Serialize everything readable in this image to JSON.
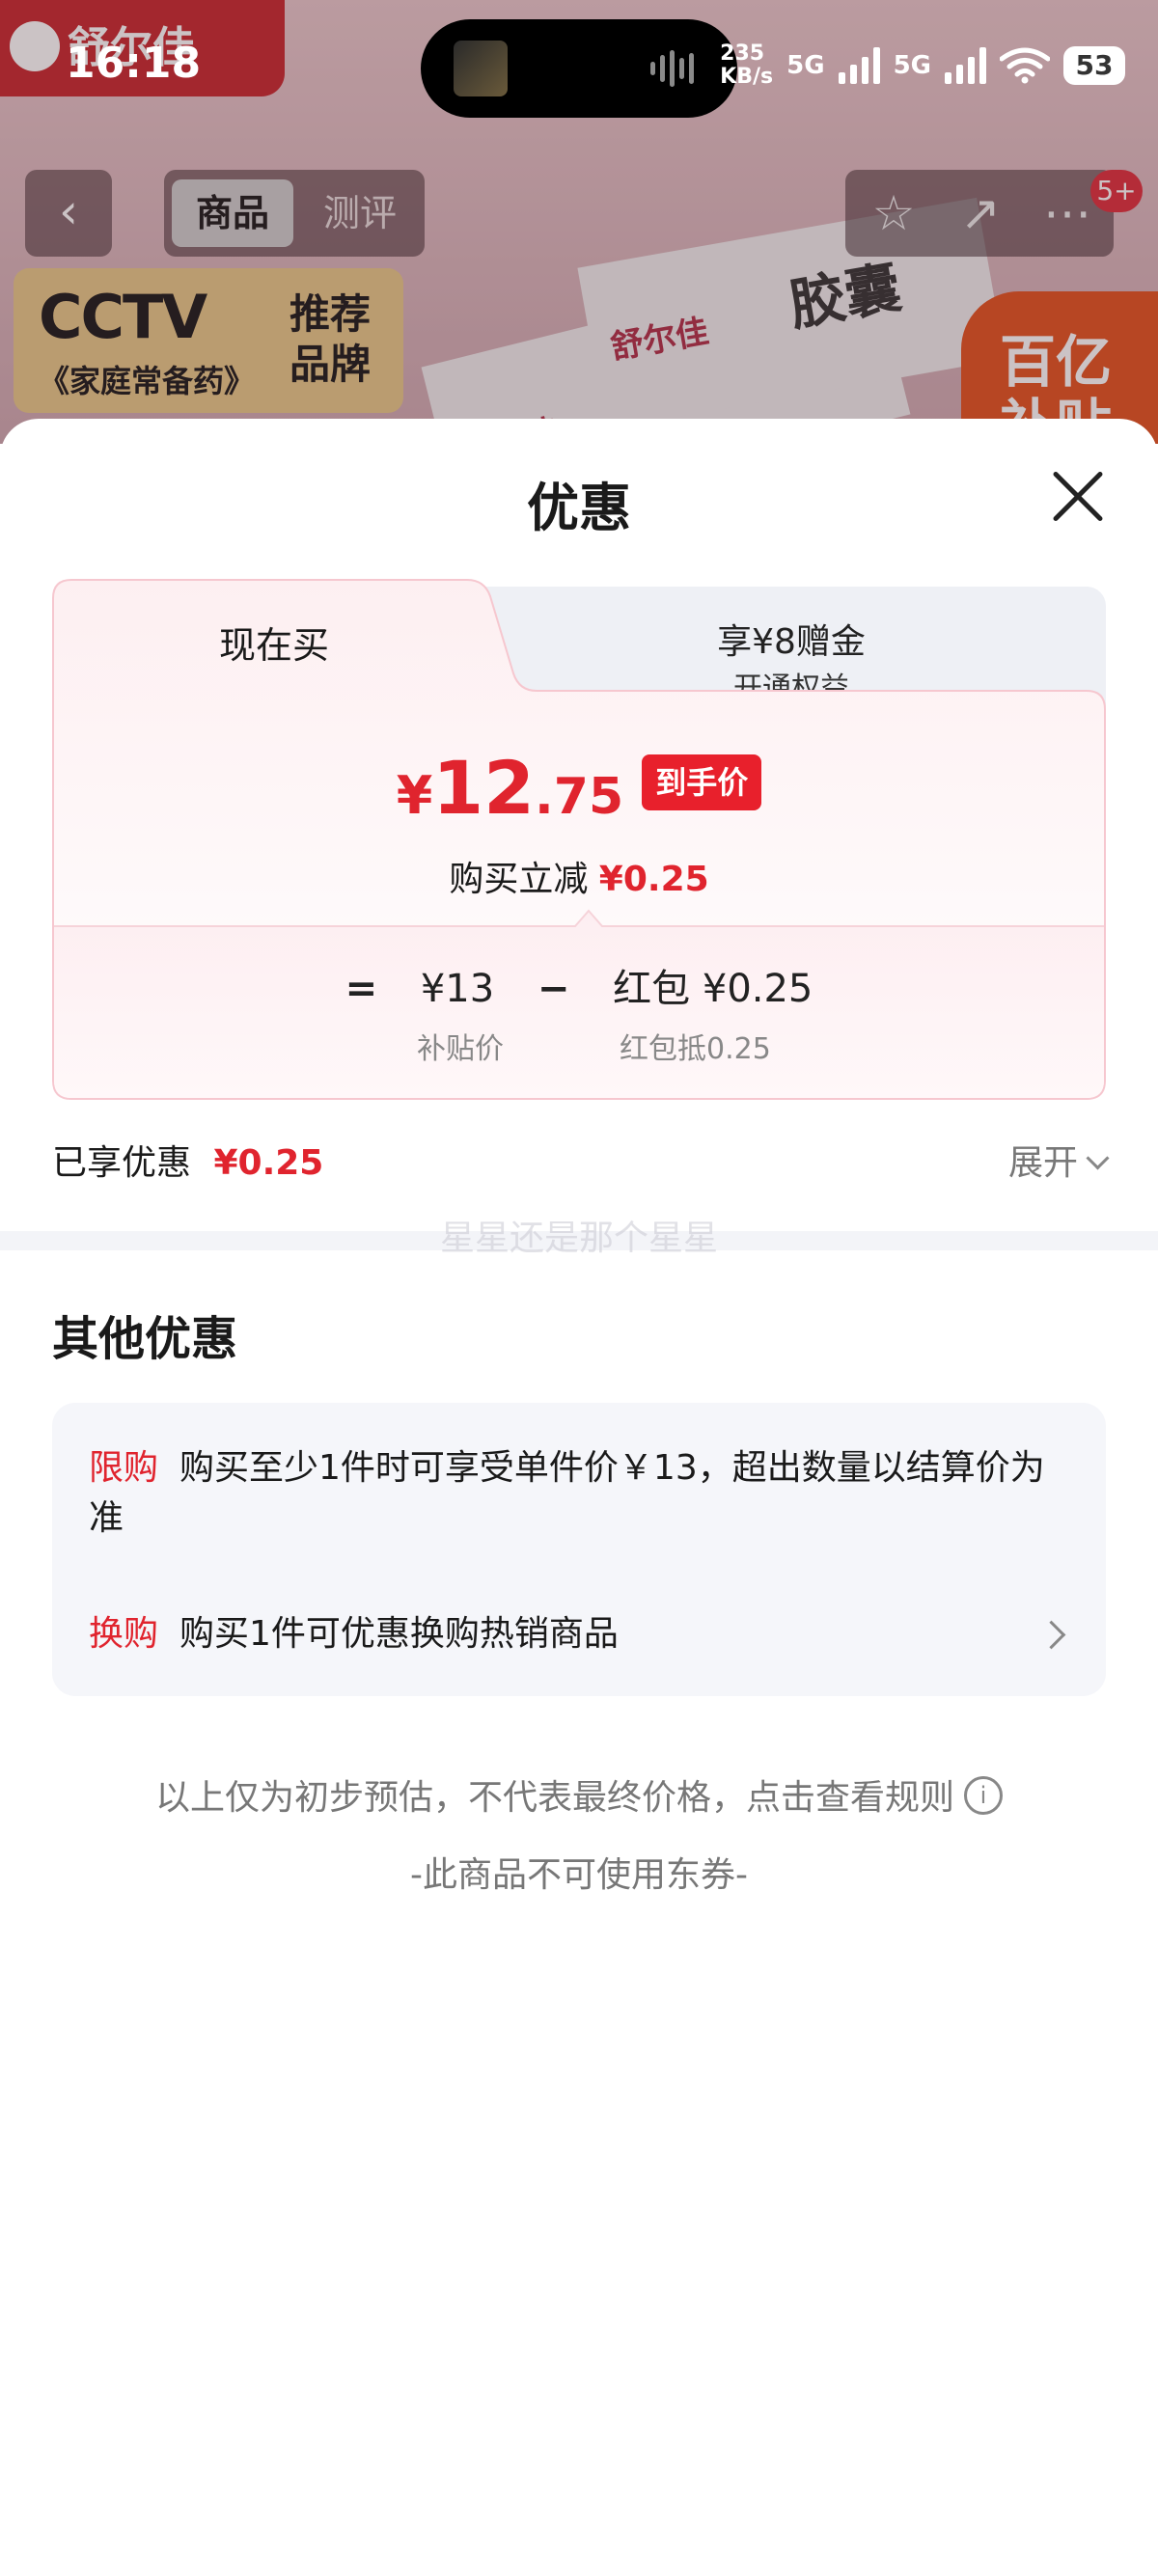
{
  "status_bar": {
    "time": "16:18",
    "speed_value": "235",
    "speed_unit": "KB/s",
    "signal1": "5G",
    "signal2": "5G",
    "battery": "53"
  },
  "background": {
    "brand": "舒尔佳",
    "nav_tabs": [
      "商品",
      "测评"
    ],
    "badge": "5+",
    "cctv_logo": "CCTV",
    "cctv_sub": "《家庭常备药》",
    "cctv_rec_1": "推荐",
    "cctv_rec_2": "品牌",
    "box_text_1": "舒尔佳",
    "box_text_2": "舒尔佳",
    "box_text_3": "胶囊",
    "subsidy_1": "百亿",
    "subsidy_2": "补贴"
  },
  "sheet": {
    "title": "优惠",
    "tab_now": "现在买",
    "tab_other_1": "享¥8赠金",
    "tab_other_2": "开通权益",
    "price_currency": "¥",
    "price_int": "12",
    "price_dec": ".75",
    "price_tag": "到手价",
    "reduce_label": "购买立减",
    "reduce_amount": "¥0.25",
    "eq": "=",
    "subsidy_price": "¥13",
    "minus": "−",
    "redpacket": "红包 ¥0.25",
    "subsidy_price_label": "补贴价",
    "redpacket_label": "红包抵0.25",
    "enjoyed_label": "已享优惠",
    "enjoyed_amount": "¥0.25",
    "expand_label": "展开",
    "watermark": "星星还是那个星星",
    "other_title": "其他优惠",
    "offers": [
      {
        "tag": "限购",
        "text": "购买至少1件时可享受单件价￥13，超出数量以结算价为准"
      },
      {
        "tag": "换购",
        "text": "购买1件可优惠换购热销商品"
      }
    ],
    "note": "以上仅为初步预估，不代表最终价格，点击查看规则",
    "note2": "-此商品不可使用东券-"
  }
}
